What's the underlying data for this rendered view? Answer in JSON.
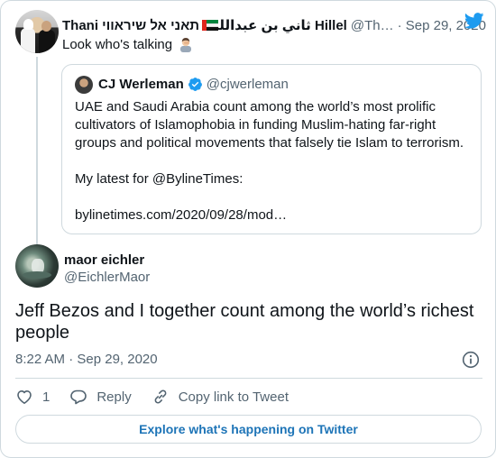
{
  "parent_tweet": {
    "author_name_a": "Thani תאני אל שיראווי",
    "author_name_b": "ثاني بن عبدالله Hillel",
    "handle": "@Th…",
    "date": "· Sep 29, 2020",
    "text": "Look who's talking",
    "flag_colors": [
      "#e0241c",
      "#00843d",
      "#ffffff",
      "#000000"
    ]
  },
  "quoted_tweet": {
    "author_name": "CJ Werleman",
    "handle": "@cjwerleman",
    "verified": true,
    "paragraph_1": "UAE and Saudi Arabia count among the world’s most prolific cultivators of Islamophobia in funding Muslim-hating far-right groups and political movements that falsely tie Islam to terrorism.",
    "paragraph_2": "My latest for @BylineTimes:",
    "paragraph_3": "bylinetimes.com/2020/09/28/mod…"
  },
  "main_tweet": {
    "author_name": "maor eichler",
    "handle": "@EichlerMaor",
    "text": "Jeff Bezos and I together count among the world’s richest people",
    "timestamp": "8:22 AM · Sep 29, 2020",
    "like_count": "1",
    "reply_label": "Reply",
    "copy_link_label": "Copy link to Tweet"
  },
  "explore_button": {
    "label": "Explore what's happening on Twitter"
  },
  "colors": {
    "accent": "#1d9bf0",
    "link": "#1d74b7",
    "secondary_text": "#536471",
    "border": "#cfd9de"
  },
  "icons": [
    "twitter-bird-icon",
    "verified-badge-icon",
    "info-icon",
    "heart-icon",
    "reply-icon",
    "link-icon",
    "man-facepalming-emoji-icon"
  ]
}
